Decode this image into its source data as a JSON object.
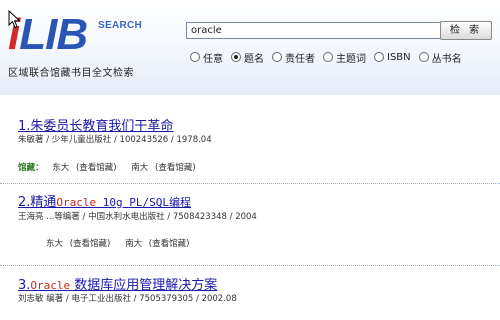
{
  "header": {
    "logo_text": "iLIB",
    "logo_search_label": "SEARCH",
    "subtitle": "区域联合馆藏书目全文检索",
    "search_value": "oracle",
    "search_button": "检 索",
    "options": [
      {
        "label": "任意",
        "checked": false
      },
      {
        "label": "题名",
        "checked": true
      },
      {
        "label": "责任者",
        "checked": false
      },
      {
        "label": "主题词",
        "checked": false
      },
      {
        "label": "ISBN",
        "checked": false
      },
      {
        "label": "丛书名",
        "checked": false
      }
    ]
  },
  "results": [
    {
      "number": "1.",
      "title_plain": "朱委员长教育我们干革命",
      "meta": "朱敏著 / 少年儿童出版社 / 100243526 / 1978.04",
      "holdings_label": "馆藏：",
      "holdings": [
        {
          "lib": "东大",
          "link": "(查看馆藏)"
        },
        {
          "lib": "南大",
          "link": "(查看馆藏)"
        }
      ]
    },
    {
      "number": "2.",
      "title_pre": "精通",
      "title_hl": "Oracle",
      "title_post": " 10g PL/SQL编程",
      "meta": "王海亮 ...等编著 / 中国水利水电出版社 / 7508423348 / 2004",
      "holdings": [
        {
          "lib": "东大",
          "link": "(查看馆藏)"
        },
        {
          "lib": "南大",
          "link": "(查看馆藏)"
        }
      ]
    },
    {
      "number": "3.",
      "title_hl": "Oracle",
      "title_post": " 数据库应用管理解决方案",
      "meta": "刘志敏 编著 / 电子工业出版社 / 7505379305 / 2002.08"
    }
  ]
}
